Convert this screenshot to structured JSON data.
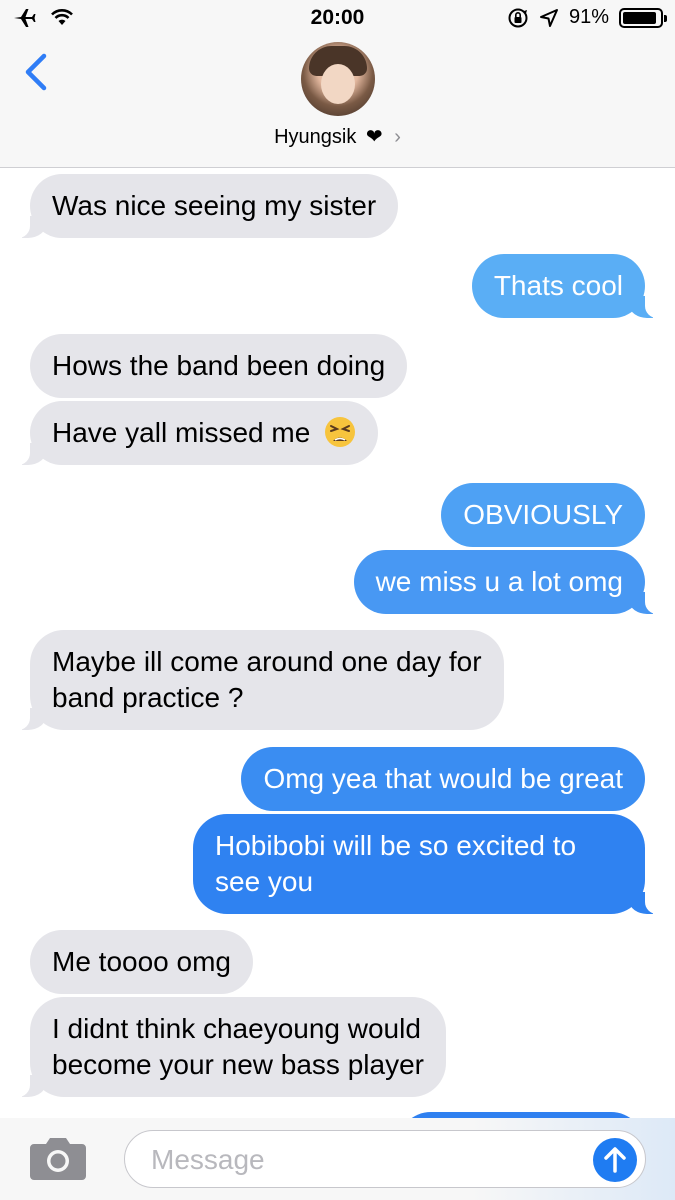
{
  "status_bar": {
    "time": "20:00",
    "battery_percent": "91%",
    "battery_level": 0.91,
    "icons": [
      "airplane-icon",
      "wifi-icon",
      "orientation-lock-icon",
      "location-icon",
      "battery-icon"
    ]
  },
  "header": {
    "contact_name": "Hyungsik",
    "heart": "❤",
    "chevron": "›"
  },
  "messages": [
    {
      "side": "received",
      "text": "Was nice seeing my sister"
    },
    {
      "side": "sent",
      "text": "Thats cool"
    },
    {
      "side": "received",
      "text": "Hows the band been doing"
    },
    {
      "side": "received",
      "text": "Have yall missed me",
      "emoji": "tired-face-emoji"
    },
    {
      "side": "sent",
      "text": "OBVIOUSLY"
    },
    {
      "side": "sent",
      "text": "we miss u a lot omg"
    },
    {
      "side": "received",
      "line1": "Maybe ill come around one day for",
      "line2": "band practice ?"
    },
    {
      "side": "sent",
      "text": "Omg yea that would be great"
    },
    {
      "side": "sent",
      "line1": "Hobibobi will be so excited to",
      "line2": "see you"
    },
    {
      "side": "received",
      "text": "Me toooo omg"
    },
    {
      "side": "received",
      "line1": "I didnt think chaeyoung would",
      "line2": "become your new bass player"
    }
  ],
  "input": {
    "placeholder": "Message"
  },
  "colors": {
    "received_bubble": "#e5e5ea",
    "sent_bubble_light": "#5aaef5",
    "sent_bubble_dark": "#2f80f0",
    "accent": "#1f7cf2"
  }
}
